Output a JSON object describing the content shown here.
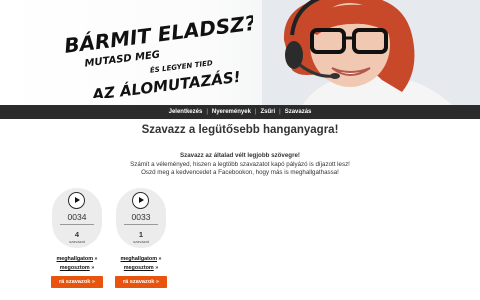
{
  "banner": {
    "slogan": {
      "line1": "BÁRMIT ELADSZ?",
      "line2": "MUTASD MEG",
      "line3": "ÉS LEGYEN TIED",
      "line4": "AZ ÁLOMUTAZÁS!"
    }
  },
  "nav": {
    "items": [
      "Jelentkezés",
      "Nyeremények",
      "Zsűri",
      "Szavazás"
    ],
    "separator": "|"
  },
  "main": {
    "title": "Szavazz a legütősebb hanganyagra!",
    "intro_bold": "Szavazz az általad vélt legjobb szövegre!",
    "intro_line2": "Számít a véleményed, hiszen a legtöbb szavazatot kapó pályázó is díjazott lesz!",
    "intro_line3": "Oszd meg a kedvencedet a Facebookon, hogy más is meghallgathassa!"
  },
  "entries": [
    {
      "number": "0034",
      "votes": "4",
      "votes_label": "szavazat",
      "listen": "meghallgatom",
      "share": "megosztom",
      "arrow": "»",
      "vote_button": "rá szavazok »"
    },
    {
      "number": "0033",
      "votes": "1",
      "votes_label": "szavazat",
      "listen": "meghallgatom",
      "share": "megosztom",
      "arrow": "»",
      "vote_button": "rá szavazok »"
    }
  ],
  "colors": {
    "nav_bg": "#2b2b2b",
    "vote_button": "#e8530e",
    "hair": "#c8482a",
    "card_bg": "#ececec"
  }
}
